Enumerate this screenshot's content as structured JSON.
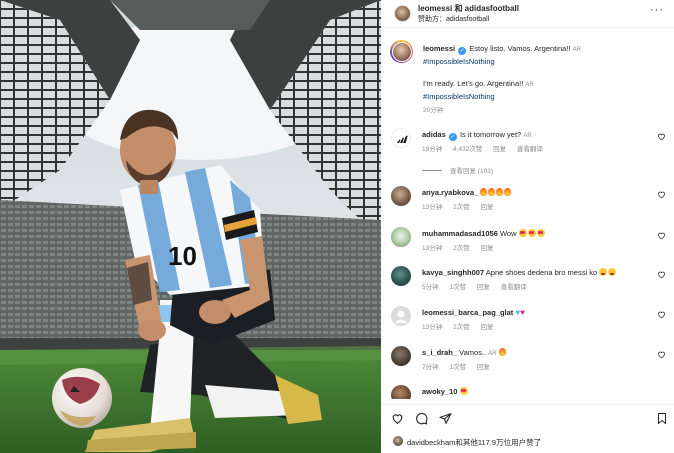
{
  "post_header": {
    "title": "leomessi 和 adidasfootball",
    "subtitle": "赞助方：adidasfootball"
  },
  "caption": {
    "username": "leomessi",
    "text": "Estoy listo. Vamos. Argentina!!",
    "ar_label": "AR",
    "hashtag": "#ImpossibleIsNothing",
    "translation": "I'm ready. Let's go. Argentina!!",
    "translation_ar": "AR",
    "translation_hashtag": "#ImpossibleIsNothing",
    "time": "20分钟"
  },
  "comments": [
    {
      "username": "adidas",
      "text": "Is it tomorrow yet?",
      "ar_label": "AR",
      "time": "18分钟",
      "likes": "4,432次赞",
      "reply": "回复",
      "translate": "查看翻译",
      "view_replies": "查看回复 (103)"
    },
    {
      "username": "anya.ryabkova_",
      "time": "13分钟",
      "likes": "2次赞",
      "reply": "回复"
    },
    {
      "username": "muhammadasad1056",
      "text": "Wow",
      "time": "13分钟",
      "likes": "2次赞",
      "reply": "回复"
    },
    {
      "username": "kavya_singhh007",
      "text": "Apne shoes dedena bro messi ko",
      "time": "5分钟",
      "likes": "1次赞",
      "reply": "回复",
      "translate": "查看翻译"
    },
    {
      "username": "leomessi_barca_pag_glat",
      "time": "13分钟",
      "likes": "2次赞",
      "reply": "回复"
    },
    {
      "username": "s_i_drah_",
      "text": "Vamos..",
      "ar_label": "AR",
      "time": "7分钟",
      "likes": "1次赞",
      "reply": "回复"
    },
    {
      "username": "awoky_10",
      "time": "",
      "likes": "",
      "reply": ""
    }
  ],
  "liked_by": "davidbeckham和其他117.9万位用户赞了",
  "icons": [
    "more-icon",
    "verified-icon",
    "heart-icon",
    "comment-icon",
    "share-icon",
    "bookmark-icon",
    "adidas-logo-icon"
  ],
  "colors": {
    "link": "#00376b",
    "verified": "#3897f0",
    "secondary_text": "#8e8e8e",
    "jersey_blue": "#75aadb"
  }
}
